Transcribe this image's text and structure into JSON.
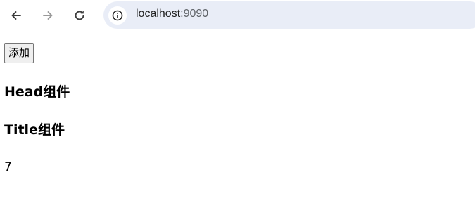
{
  "browser": {
    "url_host": "localhost",
    "url_port": ":9090",
    "icons": {
      "back": "back-arrow-icon",
      "forward": "forward-arrow-icon",
      "reload": "reload-icon",
      "site_info": "info-icon"
    }
  },
  "page": {
    "add_button_label": "添加",
    "head_component": "Head组件",
    "title_component": "Title组件",
    "count": "7"
  }
}
